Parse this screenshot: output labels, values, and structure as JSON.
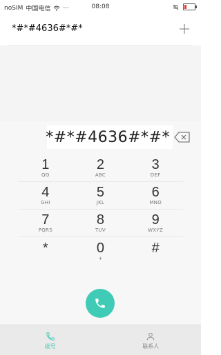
{
  "status_bar": {
    "signal_text": "noSIM",
    "carrier": "中国电信",
    "more": "···",
    "time": "08:08"
  },
  "header": {
    "number": "*#*#4636#*#*"
  },
  "display": {
    "number": "*#*#4636#*#*"
  },
  "keys": [
    {
      "digit": "1",
      "letters": "QO"
    },
    {
      "digit": "2",
      "letters": "ABC"
    },
    {
      "digit": "3",
      "letters": "DEF"
    },
    {
      "digit": "4",
      "letters": "GHI"
    },
    {
      "digit": "5",
      "letters": "JKL"
    },
    {
      "digit": "6",
      "letters": "MNO"
    },
    {
      "digit": "7",
      "letters": "PQRS"
    },
    {
      "digit": "8",
      "letters": "TUV"
    },
    {
      "digit": "9",
      "letters": "WXYZ"
    },
    {
      "digit": "*",
      "letters": ""
    },
    {
      "digit": "0",
      "letters": "+"
    },
    {
      "digit": "#",
      "letters": ""
    }
  ],
  "nav": {
    "dial_label": "拨号",
    "contacts_label": "联系人"
  },
  "colors": {
    "accent": "#3fcbb5",
    "battery_low": "#e53935"
  },
  "icons": {
    "add": "plus-icon",
    "backspace": "backspace-icon",
    "call": "phone-icon",
    "dial_tab": "phone-icon",
    "contacts_tab": "contacts-icon"
  }
}
